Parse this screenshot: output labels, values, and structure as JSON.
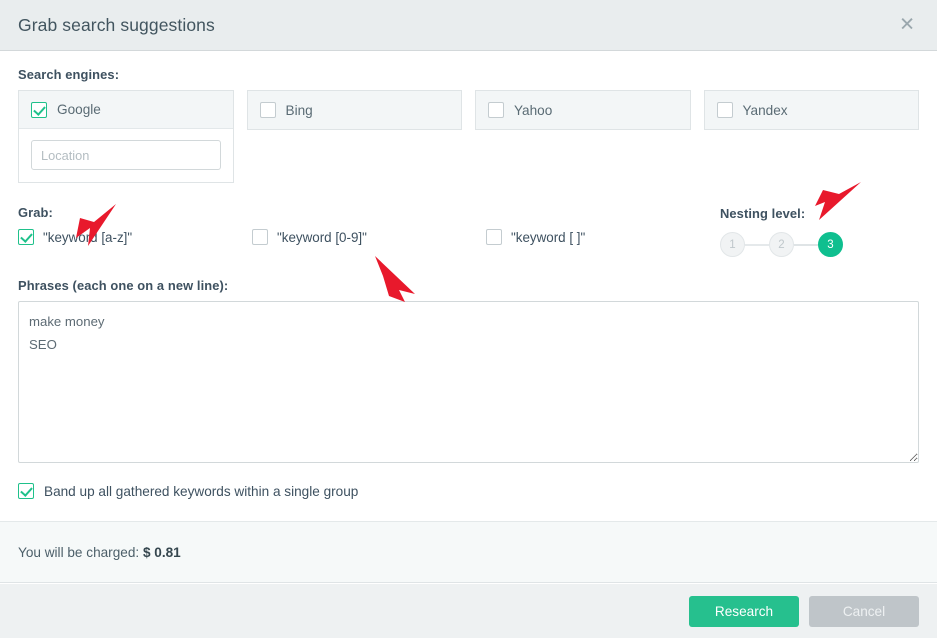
{
  "dialog": {
    "title": "Grab search suggestions",
    "close_icon": "close-icon"
  },
  "search_engines": {
    "label": "Search engines:",
    "engines": [
      {
        "name": "Google",
        "checked": true,
        "location_placeholder": "Location",
        "location_value": ""
      },
      {
        "name": "Bing",
        "checked": false
      },
      {
        "name": "Yahoo",
        "checked": false
      },
      {
        "name": "Yandex",
        "checked": false
      }
    ]
  },
  "grab": {
    "label": "Grab:",
    "options": [
      {
        "label": "\"keyword [a-z]\"",
        "checked": true
      },
      {
        "label": "\"keyword [0-9]\"",
        "checked": false
      },
      {
        "label": "\"keyword [ ]\"",
        "checked": false
      }
    ]
  },
  "nesting": {
    "label": "Nesting level:",
    "levels": [
      "1",
      "2",
      "3"
    ],
    "selected": "3"
  },
  "phrases": {
    "label": "Phrases (each one on a new line):",
    "value": "make money\nSEO",
    "placeholder": ""
  },
  "band_up": {
    "label": "Band up all gathered keywords within a single group",
    "checked": true
  },
  "charge": {
    "prefix": "You will be charged: ",
    "amount": "$ 0.81"
  },
  "footer": {
    "primary_label": "Research",
    "secondary_label": "Cancel"
  },
  "colors": {
    "accent_green": "#26c08e",
    "check_green": "#1fc18b",
    "header_bg": "#e9edee",
    "annotation_red": "#e8192c"
  },
  "annotations": [
    {
      "name": "arrow-pointing-to-keyword-az-checkbox"
    },
    {
      "name": "arrow-pointing-to-keyword-09-checkbox"
    },
    {
      "name": "arrow-pointing-to-nesting-level"
    }
  ]
}
